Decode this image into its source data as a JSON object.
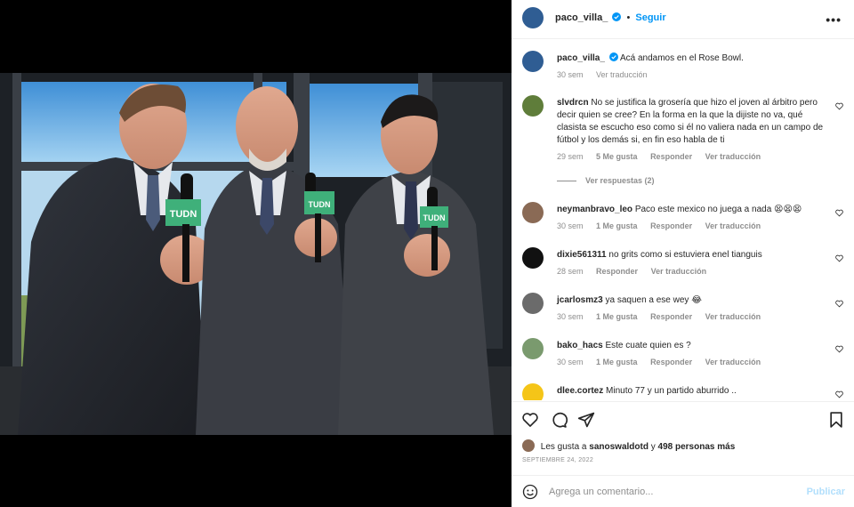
{
  "post": {
    "username": "paco_villa_",
    "separator": "•",
    "follow_label": "Seguir",
    "more_label": "•••"
  },
  "caption": {
    "username": "paco_villa_",
    "text": "Acá andamos en el Rose Bowl.",
    "age": "30 sem",
    "translate": "Ver traducción"
  },
  "comments": [
    {
      "username": "slvdrcn",
      "text": "No se justifica la grosería que hizo el joven al árbitro pero decir quien se cree? En la forma en la que la dijiste no va, qué clasista se escucho eso como si él no valiera nada en un campo de fútbol y los demás si, en fin eso habla de ti",
      "age": "29 sem",
      "likes": "5 Me gusta",
      "reply": "Responder",
      "translate": "Ver traducción",
      "replies": "Ver respuestas (2)"
    },
    {
      "username": "neymanbravo_leo",
      "text": "Paco este mexico no juega a nada 😫😫😫",
      "age": "30 sem",
      "likes": "1 Me gusta",
      "reply": "Responder",
      "translate": "Ver traducción"
    },
    {
      "username": "dixie561311",
      "text": "no grits como si estuviera enel tianguis",
      "age": "28 sem",
      "reply": "Responder",
      "translate": "Ver traducción"
    },
    {
      "username": "jcarlosmz3",
      "text": "ya saquen a ese wey 😂",
      "age": "30 sem",
      "likes": "1 Me gusta",
      "reply": "Responder",
      "translate": "Ver traducción"
    },
    {
      "username": "bako_hacs",
      "text": "Este cuate quien es ?",
      "age": "30 sem",
      "likes": "1 Me gusta",
      "reply": "Responder",
      "translate": "Ver traducción"
    },
    {
      "username": "dlee.cortez",
      "text": "Minuto 77 y un partido aburrido ..",
      "age": "",
      "likes": "",
      "reply": "",
      "translate": ""
    }
  ],
  "likes": {
    "prefix": "Les gusta a",
    "user": "sanoswaldotd",
    "conj": "y",
    "others": "498 personas más"
  },
  "date": "SEPTIEMBRE 24, 2022",
  "add_comment": {
    "placeholder": "Agrega un comentario...",
    "post_label": "Publicar"
  },
  "photo": {
    "mic_label": "TUDN"
  },
  "colors": {
    "accent": "#0095f6",
    "tudn_green": "#3fb07a",
    "text": "#262626",
    "muted": "#8e8e8e"
  },
  "icons": [
    "verified-icon",
    "more-options-icon",
    "heart-icon",
    "comment-icon",
    "share-icon",
    "bookmark-icon",
    "emoji-icon"
  ]
}
